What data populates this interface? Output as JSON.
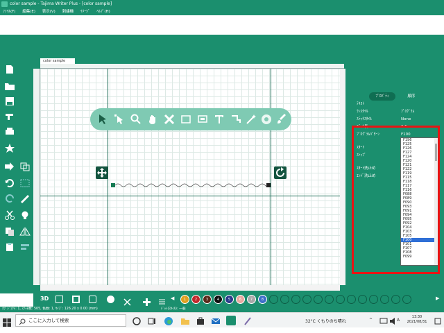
{
  "window": {
    "title": "color sample - Tajima Writer Plus - [color sample]"
  },
  "menu": [
    "ﾌｧｲﾙ(F)",
    "編集(E)",
    "表示(V)",
    "刺繍機",
    "ｲﾒｰｼﾞ",
    "ﾍﾙﾌﾟ(H)"
  ],
  "document_tab": "color sample",
  "panel": {
    "tab_properties": "ﾌﾟﾛﾊﾟﾃｨ",
    "tab_order": "順序",
    "rows": [
      {
        "label": "ﾃｷｽﾄ",
        "value": ""
      },
      {
        "label": "ﾗﾝｽﾀｲﾙ",
        "value": "ﾌﾟﾛｸﾞﾗﾑ"
      },
      {
        "label": "ｽﾃｯﾁｽﾀｲﾙ",
        "value": "None"
      },
      {
        "label": "ｽﾃｯﾁ長",
        "value": "2.5 mm"
      },
      {
        "label": "ﾌﾟﾛｸﾞﾗﾑﾊﾟﾀｰﾝ",
        "value": "F100"
      },
      {
        "label": "ｽﾀｰﾄ",
        "value": ""
      },
      {
        "label": "ｽﾄｯﾌﾟ",
        "value": ""
      },
      {
        "label": "ｽﾀｰﾄ洗止め",
        "value": ""
      },
      {
        "label": "ｴﾝﾄﾞ洗止め",
        "value": ""
      }
    ],
    "pattern_options": [
      "F196",
      "F125",
      "F126",
      "F127",
      "F124",
      "F120",
      "F121",
      "F122",
      "F119",
      "F115",
      "F118",
      "F117",
      "F116",
      "F088",
      "F089",
      "F090",
      "F093",
      "F091",
      "F094",
      "F095",
      "F092",
      "F104",
      "F103",
      "F105",
      "F100",
      "F101",
      "F107",
      "F108",
      "F099"
    ],
    "pattern_selected": "F100"
  },
  "palette": {
    "swatches": [
      {
        "num": "1",
        "color": "#e0a020"
      },
      {
        "num": "2",
        "color": "#c0282c"
      },
      {
        "num": "3",
        "color": "#5a2a1a"
      },
      {
        "num": "4",
        "color": "#101010"
      },
      {
        "num": "5",
        "color": "#2a3a8a"
      },
      {
        "num": "6",
        "color": "#e8a8a0"
      },
      {
        "num": "7",
        "color": "#a8a8a8"
      },
      {
        "num": "8",
        "color": "#3c6ec8"
      },
      {
        "num": "",
        "color": "#1b8f6e"
      },
      {
        "num": "",
        "color": "#1b8f6e"
      },
      {
        "num": "",
        "color": "#1b8f6e"
      },
      {
        "num": "",
        "color": "#1b8f6e"
      },
      {
        "num": "",
        "color": "#1b8f6e"
      },
      {
        "num": "",
        "color": "#1b8f6e"
      },
      {
        "num": "",
        "color": "#1b8f6e"
      },
      {
        "num": "",
        "color": "#1b8f6e"
      },
      {
        "num": "",
        "color": "#1b8f6e"
      },
      {
        "num": "",
        "color": "#1b8f6e"
      },
      {
        "num": "",
        "color": "#1b8f6e"
      },
      {
        "num": "",
        "color": "#1b8f6e"
      },
      {
        "num": "",
        "color": "#1b8f6e"
      }
    ]
  },
  "status": {
    "left": "ｵﾌﾞｼﾞｪｸﾄ: 1, ｽﾃｯﾁ数: 505, 色数: 1, ｻｲｽﾞ: 126.20 x 0.00 (mm)",
    "mid": "ﾄﾞｯﾄ(ｽﾀｲﾙ): 一般"
  },
  "taskbar": {
    "search_placeholder": "ここに入力して検索",
    "weather": "32°C くもりのち晴れ",
    "time": "13:30",
    "date": "2021/08/31"
  }
}
